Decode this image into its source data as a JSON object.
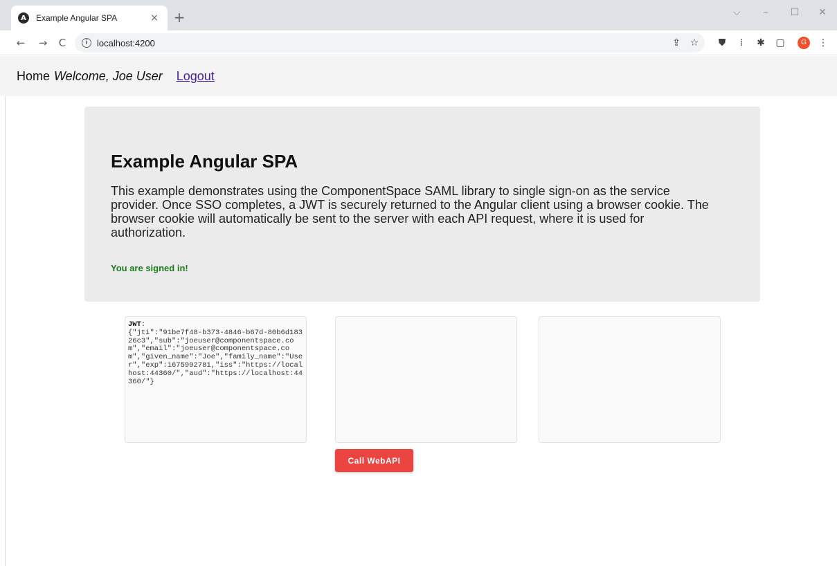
{
  "browser": {
    "tab": {
      "title": "Example Angular SPA",
      "favicon": "angular-icon",
      "favicon_glyph": "A",
      "close_glyph": "×"
    },
    "newtab_glyph": "+",
    "window_controls": {
      "dropdown": "⌵",
      "minimize": "–",
      "maximize": "☐",
      "close": "✕"
    },
    "toolbar": {
      "back": "←",
      "forward": "→",
      "reload": "C",
      "url": "localhost:4200",
      "info_glyph": "i",
      "icons": [
        "share-icon",
        "bookmark-star-icon",
        "extension-shield-icon",
        "extension-bar-icon",
        "puzzle-extensions-icon",
        "side-panel-icon"
      ],
      "icon_glyphs": [
        "⇪",
        "☆",
        "⛊",
        "⁞",
        "✱",
        "▢"
      ],
      "avatar_letter": "G",
      "menu_glyph": "⋮"
    }
  },
  "nav": {
    "home": "Home",
    "welcome": "Welcome, Joe User",
    "logout": "Logout"
  },
  "jumbotron": {
    "title": "Example Angular SPA",
    "description": "This example demonstrates using the ComponentSpace SAML library to single sign-on as the service provider. Once SSO completes, a JWT is securely returned to the Angular client using a browser cookie. The browser cookie will automatically be sent to the server with each API request, where it is used for authorization.",
    "status": "You are signed in!"
  },
  "panels": {
    "jwt_label": "JWT",
    "jwt_colon": ":",
    "jwt_value": "{\"jti\":\"91be7f48-b373-4846-b67d-80b6d18326c3\",\"sub\":\"joeuser@componentspace.com\",\"email\":\"joeuser@componentspace.com\",\"given_name\":\"Joe\",\"family_name\":\"User\",\"exp\":1675992781,\"iss\":\"https://localhost:44360/\",\"aud\":\"https://localhost:44360/\"}",
    "middle": "",
    "right": ""
  },
  "actions": {
    "call_webapi": "Call WebAPI"
  },
  "colors": {
    "status_green": "#1a7d1a",
    "button_red": "#ec4440",
    "logout_link": "#4b1f9b",
    "avatar": "#f0502e"
  }
}
